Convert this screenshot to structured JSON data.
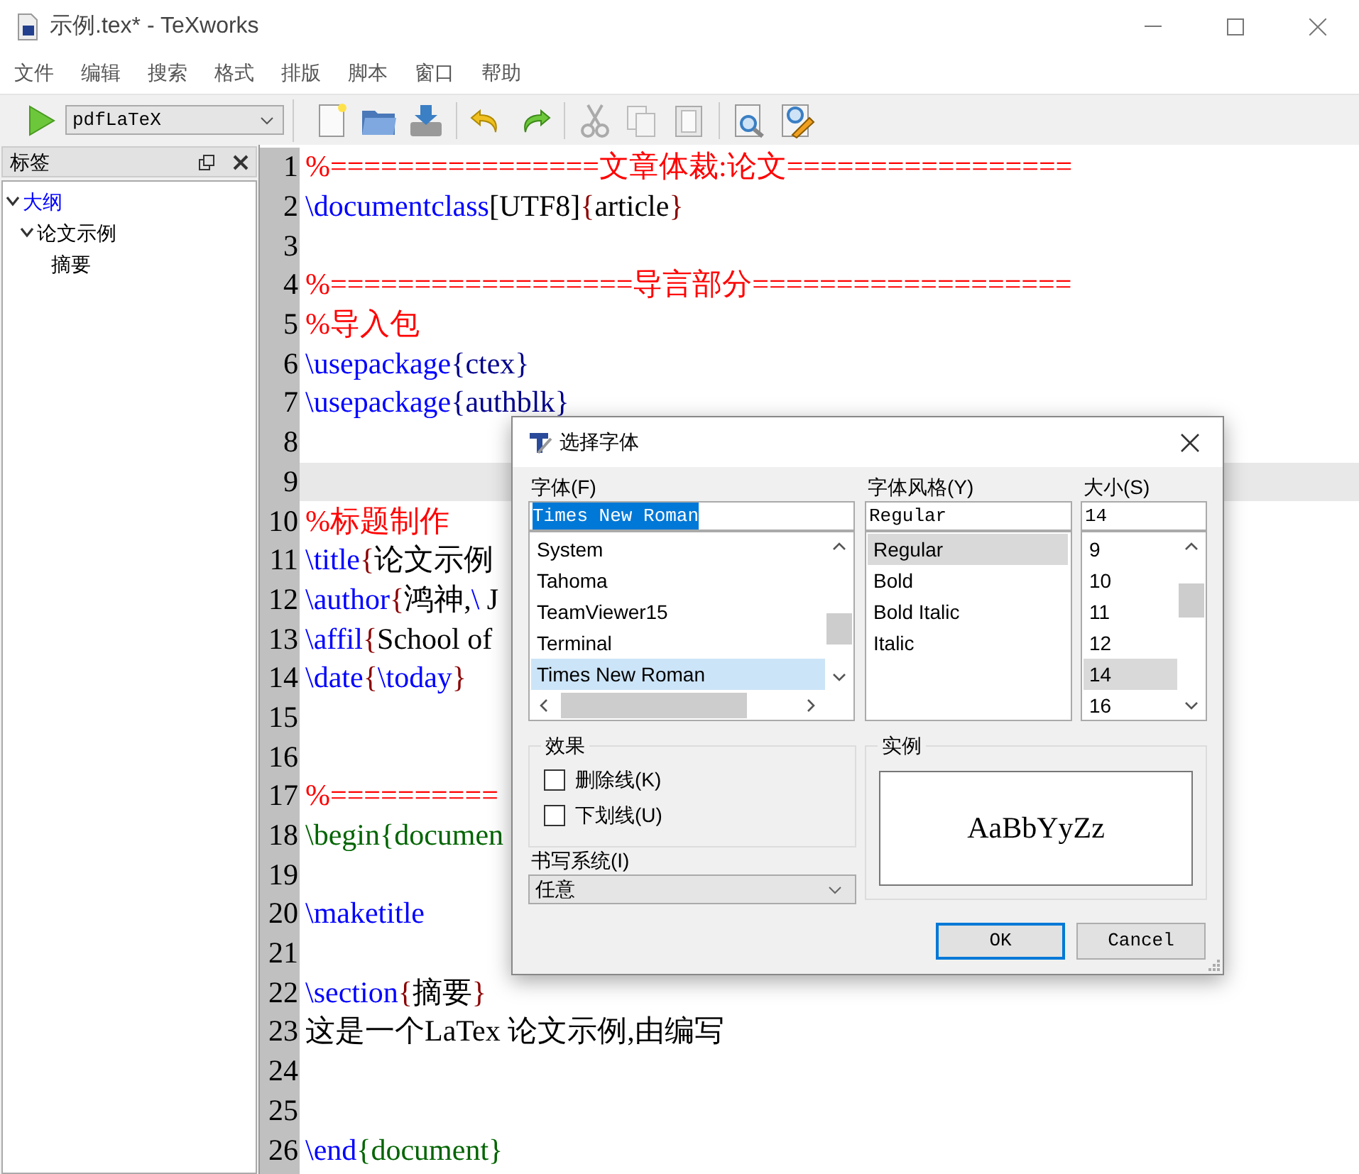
{
  "window": {
    "title": "示例.tex* - TeXworks"
  },
  "menu": [
    "文件",
    "编辑",
    "搜索",
    "格式",
    "排版",
    "脚本",
    "窗口",
    "帮助"
  ],
  "toolbar": {
    "engine": "pdfLaTeX"
  },
  "side_panel": {
    "title": "标签",
    "tree": [
      {
        "label": "大纲",
        "expanded": true,
        "children": [
          {
            "label": "论文示例",
            "expanded": true,
            "children": [
              {
                "label": "摘要"
              }
            ]
          }
        ]
      }
    ]
  },
  "editor": {
    "lines": [
      {
        "number": "1",
        "current": false,
        "segments": [
          {
            "kind": "comment",
            "text": "%================文章体裁:论文================="
          }
        ]
      },
      {
        "number": "2",
        "current": false,
        "segments": [
          {
            "kind": "command",
            "text": "\\documentclass"
          },
          {
            "kind": "text",
            "text": "[UTF8]"
          },
          {
            "kind": "brace",
            "text": "{"
          },
          {
            "kind": "text",
            "text": "article"
          },
          {
            "kind": "brace",
            "text": "}"
          }
        ]
      },
      {
        "number": "3",
        "current": false
      },
      {
        "number": "4",
        "current": false,
        "segments": [
          {
            "kind": "comment",
            "text": "%==================导言部分==================="
          }
        ]
      },
      {
        "number": "5",
        "current": false,
        "segments": [
          {
            "kind": "comment",
            "text": "%导入包"
          }
        ]
      },
      {
        "number": "6",
        "current": false,
        "segments": [
          {
            "kind": "command",
            "text": "\\usepackage"
          },
          {
            "kind": "arg",
            "text": "{ctex}"
          }
        ]
      },
      {
        "number": "7",
        "current": false,
        "segments": [
          {
            "kind": "command",
            "text": "\\usepackage"
          },
          {
            "kind": "arg",
            "text": "{authblk}"
          }
        ]
      },
      {
        "number": "8",
        "current": false
      },
      {
        "number": "9",
        "current": true
      },
      {
        "number": "10",
        "current": false,
        "segments": [
          {
            "kind": "comment",
            "text": "%标题制作"
          }
        ]
      },
      {
        "number": "11",
        "current": false,
        "segments": [
          {
            "kind": "command",
            "text": "\\title"
          },
          {
            "kind": "brace",
            "text": "{"
          },
          {
            "kind": "text",
            "text": "论文示例"
          }
        ]
      },
      {
        "number": "12",
        "current": false,
        "segments": [
          {
            "kind": "command",
            "text": "\\author"
          },
          {
            "kind": "brace",
            "text": "{"
          },
          {
            "kind": "text",
            "text": "鸿神,"
          },
          {
            "kind": "command",
            "text": "\\ "
          },
          {
            "kind": "text",
            "text": "J"
          }
        ]
      },
      {
        "number": "13",
        "current": false,
        "segments": [
          {
            "kind": "command",
            "text": "\\affil"
          },
          {
            "kind": "brace",
            "text": "{"
          },
          {
            "kind": "text",
            "text": "School of"
          }
        ]
      },
      {
        "number": "14",
        "current": false,
        "segments": [
          {
            "kind": "command",
            "text": "\\date"
          },
          {
            "kind": "brace",
            "text": "{"
          },
          {
            "kind": "command",
            "text": "\\today"
          },
          {
            "kind": "brace",
            "text": "}"
          }
        ]
      },
      {
        "number": "15",
        "current": false
      },
      {
        "number": "16",
        "current": false
      },
      {
        "number": "17",
        "current": false,
        "segments": [
          {
            "kind": "comment",
            "text": "%=========="
          }
        ]
      },
      {
        "number": "18",
        "current": false,
        "segments": [
          {
            "kind": "env",
            "text": "\\begin{documen"
          }
        ]
      },
      {
        "number": "19",
        "current": false
      },
      {
        "number": "20",
        "current": false,
        "segments": [
          {
            "kind": "command",
            "text": "\\maketitle"
          }
        ]
      },
      {
        "number": "21",
        "current": false
      },
      {
        "number": "22",
        "current": false,
        "segments": [
          {
            "kind": "command",
            "text": "\\section"
          },
          {
            "kind": "brace",
            "text": "{"
          },
          {
            "kind": "text",
            "text": "摘要"
          },
          {
            "kind": "brace",
            "text": "}"
          }
        ]
      },
      {
        "number": "23",
        "current": false,
        "segments": [
          {
            "kind": "text",
            "text": "这是一个LaTex 论文示例,由编写"
          }
        ]
      },
      {
        "number": "24",
        "current": false
      },
      {
        "number": "25",
        "current": false
      },
      {
        "number": "26",
        "current": false,
        "segments": [
          {
            "kind": "command",
            "text": "\\end"
          },
          {
            "kind": "env",
            "text": "{document}"
          }
        ]
      }
    ]
  },
  "dialog": {
    "title": "选择字体",
    "font": {
      "label": "字体(F)",
      "value": "Times New Roman",
      "value_selected": true,
      "items": [
        {
          "label": "System",
          "selected": false
        },
        {
          "label": "Tahoma",
          "selected": false
        },
        {
          "label": "TeamViewer15",
          "selected": false
        },
        {
          "label": "Terminal",
          "selected": false
        },
        {
          "label": "Times New Roman",
          "selected": true
        }
      ]
    },
    "style": {
      "label": "字体风格(Y)",
      "value": "Regular",
      "items": [
        {
          "label": "Regular",
          "selected": true
        },
        {
          "label": "Bold",
          "selected": false
        },
        {
          "label": "Bold Italic",
          "selected": false
        },
        {
          "label": "Italic",
          "selected": false
        }
      ]
    },
    "size": {
      "label": "大小(S)",
      "value": "14",
      "items": [
        {
          "label": "9",
          "selected": false
        },
        {
          "label": "10",
          "selected": false
        },
        {
          "label": "11",
          "selected": false
        },
        {
          "label": "12",
          "selected": false
        },
        {
          "label": "14",
          "selected": true
        },
        {
          "label": "16",
          "selected": false
        }
      ]
    },
    "effects": {
      "title": "效果",
      "options": [
        {
          "label": "删除线(K)",
          "checked": false
        },
        {
          "label": "下划线(U)",
          "checked": false
        }
      ]
    },
    "writing_system": {
      "label": "书写系统(I)",
      "value": "任意"
    },
    "sample": {
      "title": "实例",
      "text": "AaBbYyZz"
    },
    "buttons": [
      {
        "label": "OK",
        "default": true
      },
      {
        "label": "Cancel",
        "default": false
      }
    ]
  }
}
